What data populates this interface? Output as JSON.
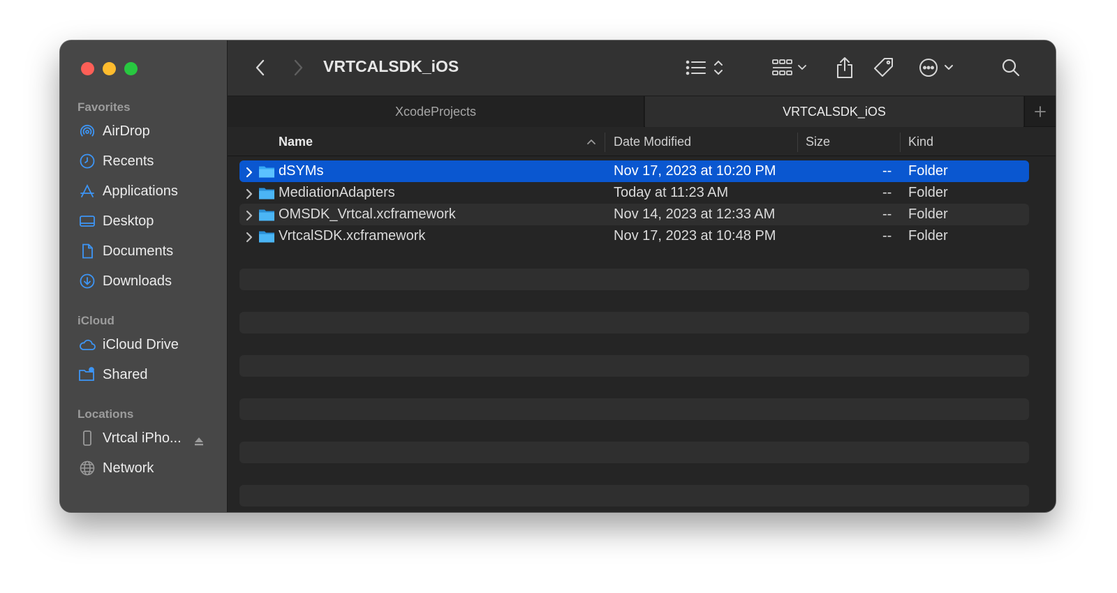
{
  "window": {
    "title": "VRTCALSDK_iOS"
  },
  "sidebar": {
    "sections": [
      {
        "title": "Favorites",
        "items": [
          {
            "label": "AirDrop",
            "icon": "airdrop-icon"
          },
          {
            "label": "Recents",
            "icon": "clock-icon"
          },
          {
            "label": "Applications",
            "icon": "applications-icon"
          },
          {
            "label": "Desktop",
            "icon": "desktop-icon"
          },
          {
            "label": "Documents",
            "icon": "document-icon"
          },
          {
            "label": "Downloads",
            "icon": "download-icon"
          }
        ]
      },
      {
        "title": "iCloud",
        "items": [
          {
            "label": "iCloud Drive",
            "icon": "cloud-icon"
          },
          {
            "label": "Shared",
            "icon": "shared-folder-icon"
          }
        ]
      },
      {
        "title": "Locations",
        "items": [
          {
            "label": "Vrtcal iPho...",
            "icon": "iphone-icon"
          },
          {
            "label": "Network",
            "icon": "globe-icon"
          }
        ]
      }
    ]
  },
  "toolbar": {
    "back_icon": "chevron-left-icon",
    "forward_icon": "chevron-right-icon",
    "view_icon": "list-view-icon",
    "group_icon": "grid-icon",
    "share_icon": "share-icon",
    "tag_icon": "tag-icon",
    "more_icon": "ellipsis-circle-icon",
    "search_icon": "search-icon"
  },
  "tabs": [
    {
      "label": "XcodeProjects",
      "active": false
    },
    {
      "label": "VRTCALSDK_iOS",
      "active": true
    }
  ],
  "columns": {
    "name": "Name",
    "date": "Date Modified",
    "size": "Size",
    "kind": "Kind"
  },
  "files": [
    {
      "name": "dSYMs",
      "date": "Nov 17, 2023 at 10:20 PM",
      "size": "--",
      "kind": "Folder",
      "selected": true
    },
    {
      "name": "MediationAdapters",
      "date": "Today at 11:23 AM",
      "size": "--",
      "kind": "Folder",
      "selected": false
    },
    {
      "name": "OMSDK_Vrtcal.xcframework",
      "date": "Nov 14, 2023 at 12:33 AM",
      "size": "--",
      "kind": "Folder",
      "selected": false
    },
    {
      "name": "VrtcalSDK.xcframework",
      "date": "Nov 17, 2023 at 10:48 PM",
      "size": "--",
      "kind": "Folder",
      "selected": false
    }
  ],
  "colors": {
    "accent": "#0a57d0",
    "folder": "#35a9f5",
    "sidebar_icon": "#3d95f5"
  }
}
